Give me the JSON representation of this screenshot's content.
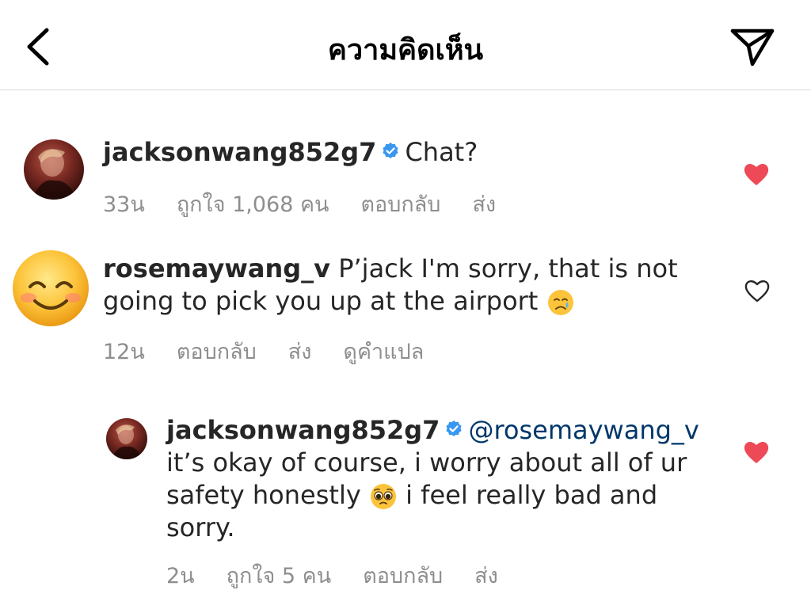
{
  "header": {
    "title": "ความคิดเห็น",
    "back_icon": "chevron-left-icon",
    "send_icon": "paper-plane-icon"
  },
  "colors": {
    "liked_heart": "#ed4956",
    "meta_gray": "#8e8e8e",
    "verified_blue": "#3897f0",
    "mention_blue": "#00376b"
  },
  "comments": [
    {
      "username": "jacksonwang852g7",
      "verified": true,
      "text": "Chat?",
      "time": "33น",
      "likes": "ถูกใจ 1,068 คน",
      "reply": "ตอบกลับ",
      "send": "ส่ง",
      "liked": true
    },
    {
      "username": "rosemaywang_v",
      "verified": false,
      "text": "P’jack I'm sorry, that is not going to pick you up at the airport",
      "emoji": "crying-face-emoji",
      "time": "12น",
      "reply": "ตอบกลับ",
      "send": "ส่ง",
      "translate": "ดูคำแปล",
      "liked": false
    },
    {
      "username": "jacksonwang852g7",
      "verified": true,
      "mention": "@rosemaywang_v",
      "text_before_emoji": "it’s okay of course, i worry about all of ur safety honestly",
      "emoji": "pleading-face-emoji",
      "text_after_emoji": "i feel really bad and sorry.",
      "time": "2น",
      "likes": "ถูกใจ 5 คน",
      "reply": "ตอบกลับ",
      "send": "ส่ง",
      "liked": true
    }
  ]
}
